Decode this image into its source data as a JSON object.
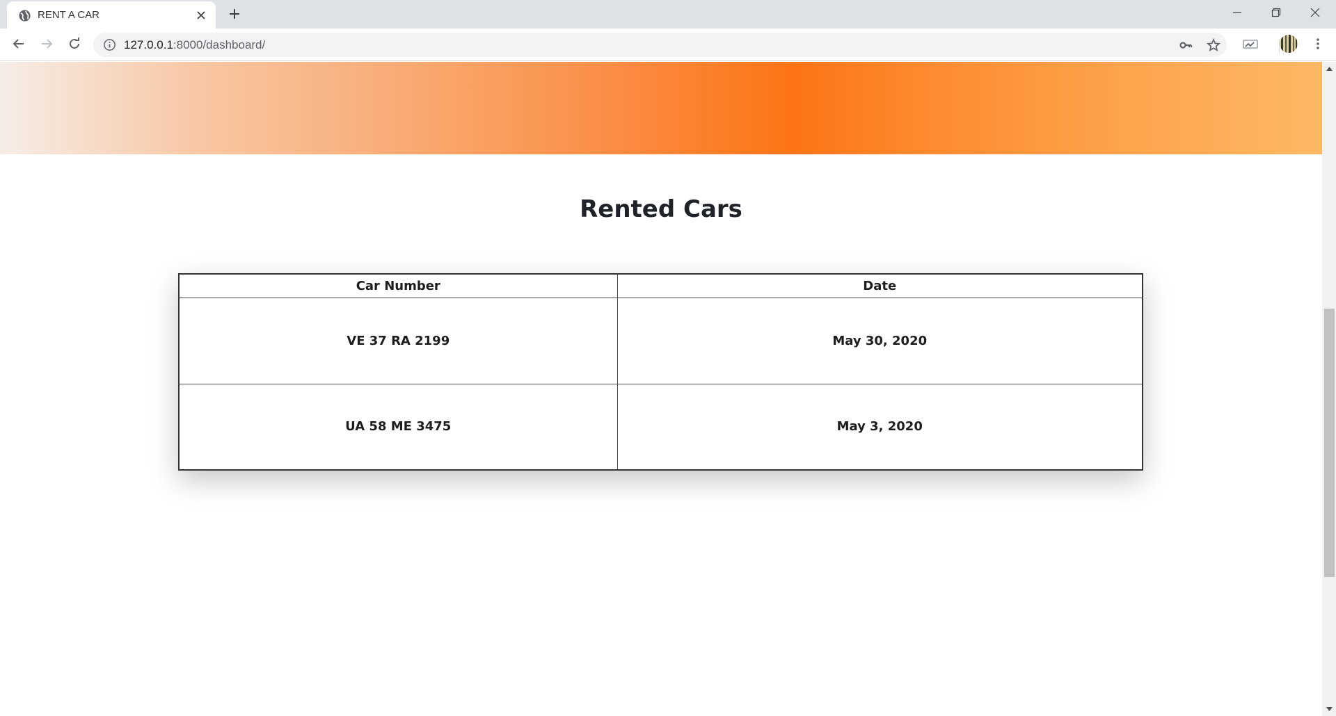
{
  "browser": {
    "tab_title": "RENT A CAR",
    "url_host": "127.0.0.1",
    "url_path": ":8000/dashboard/",
    "icons": {
      "favicon": "globe-icon",
      "close": "close-icon",
      "new_tab": "plus-icon",
      "back": "arrow-left-icon",
      "forward": "arrow-right-icon",
      "reload": "reload-icon",
      "info": "info-icon",
      "key": "key-icon",
      "star": "star-icon",
      "media": "media-router-icon",
      "profile": "profile-avatar-icon",
      "menu": "kebab-menu-icon",
      "minimize": "minimize-icon",
      "restore": "restore-icon",
      "window_close": "window-close-icon"
    }
  },
  "page": {
    "title": "Rented Cars",
    "table": {
      "headers": [
        "Car Number",
        "Date"
      ],
      "rows": [
        [
          "VE 37 RA 2199",
          "May 30, 2020"
        ],
        [
          "UA 58 ME 3475",
          "May 3, 2020"
        ]
      ]
    }
  },
  "colors": {
    "hero_orange": "#fd7414",
    "hero_light": "#f6ede7",
    "tab_strip": "#dee1e6"
  }
}
